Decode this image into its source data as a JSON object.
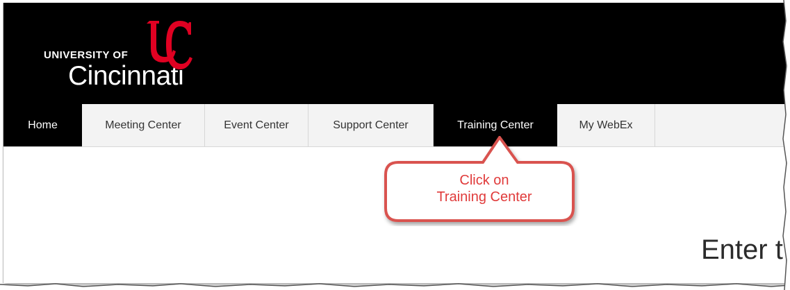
{
  "logo": {
    "line1": "UNIVERSITY OF",
    "line2": "Cincinnati",
    "brand_color": "#e00122"
  },
  "nav": {
    "tabs": [
      {
        "label": "Home",
        "active": true
      },
      {
        "label": "Meeting Center",
        "active": false
      },
      {
        "label": "Event Center",
        "active": false
      },
      {
        "label": "Support Center",
        "active": false
      },
      {
        "label": "Training Center",
        "active": true
      },
      {
        "label": "My WebEx",
        "active": false
      }
    ]
  },
  "callout": {
    "line1": "Click on",
    "line2": "Training Center",
    "border_color": "#d9534f",
    "text_color": "#e03a3a"
  },
  "main": {
    "heading_partial": "Enter t"
  }
}
